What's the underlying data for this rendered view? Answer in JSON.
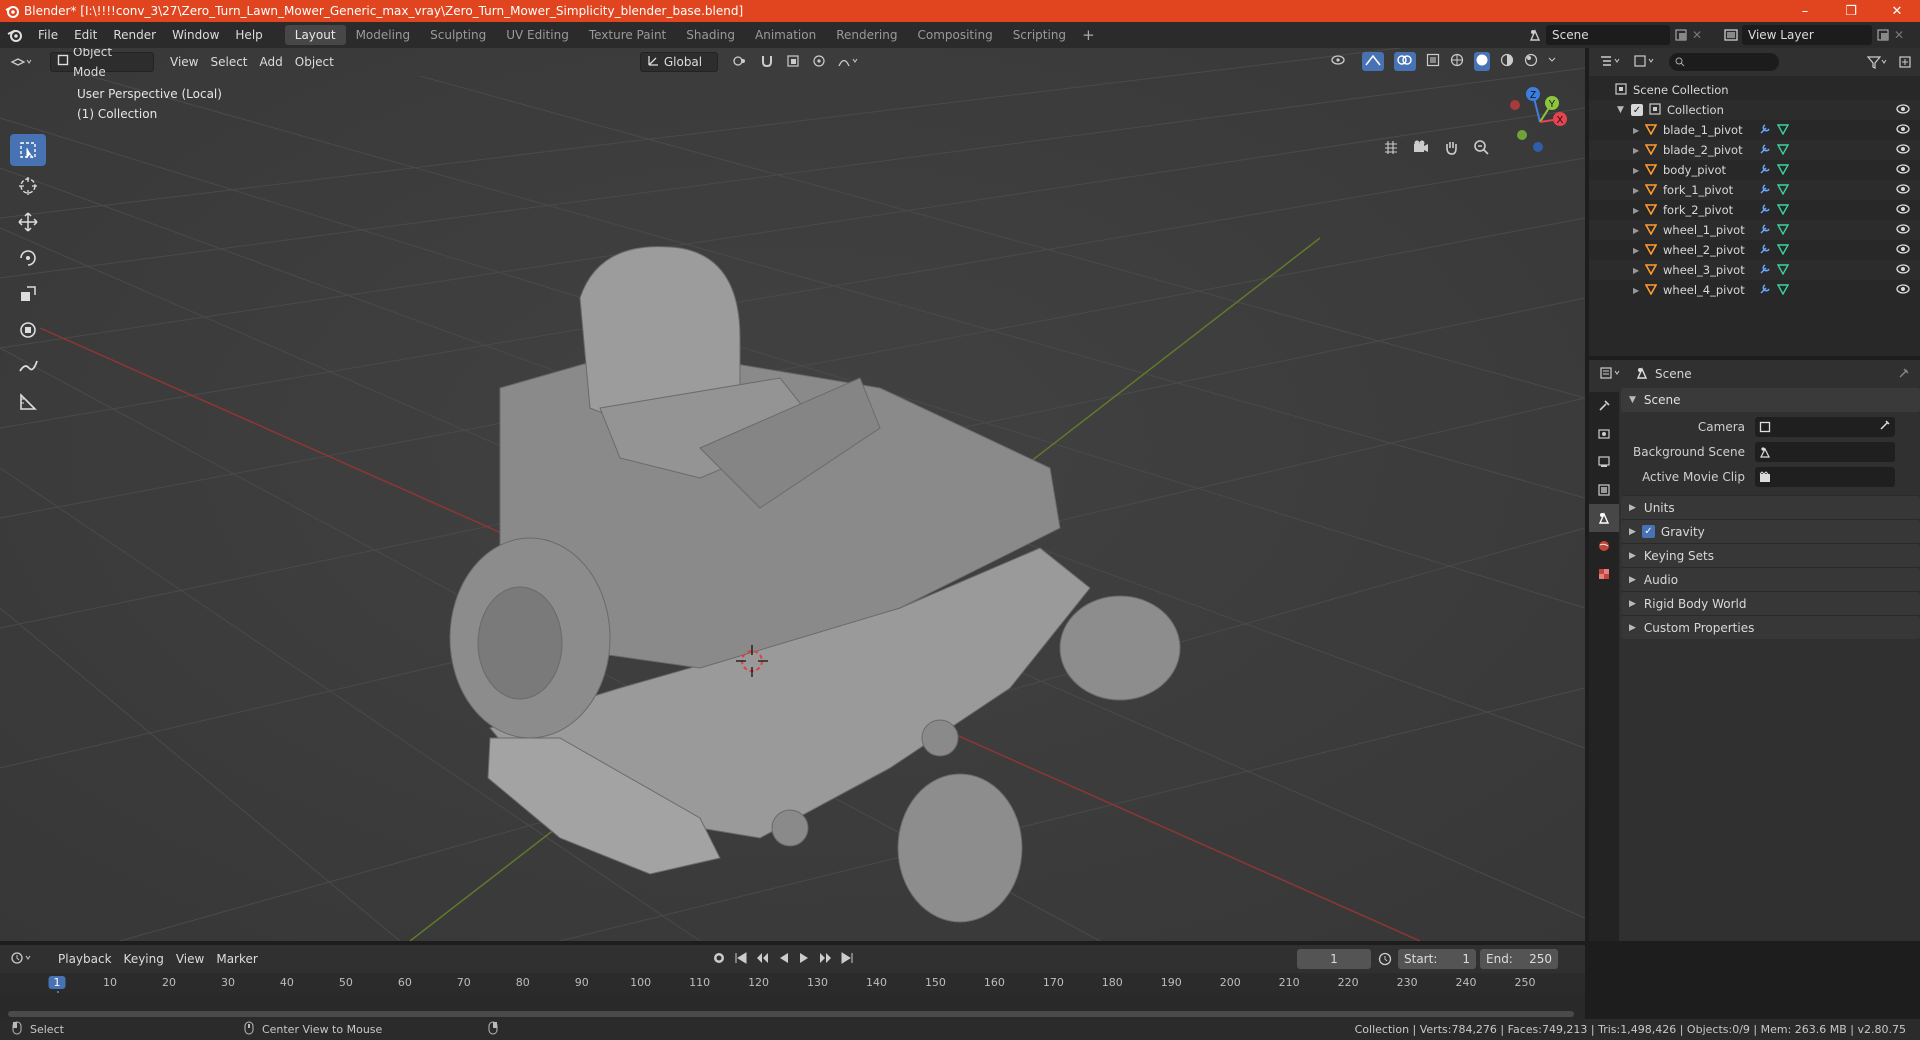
{
  "window": {
    "title": "Blender* [I:\\!!!!conv_3\\27\\Zero_Turn_Lawn_Mower_Generic_max_vray\\Zero_Turn_Mower_Simplicity_blender_base.blend]",
    "minimize": "–",
    "maximize": "❐",
    "close": "✕"
  },
  "menu": [
    "File",
    "Edit",
    "Render",
    "Window",
    "Help"
  ],
  "workspaces": [
    "Layout",
    "Modeling",
    "Sculpting",
    "UV Editing",
    "Texture Paint",
    "Shading",
    "Animation",
    "Rendering",
    "Compositing",
    "Scripting"
  ],
  "workspace_add": "+",
  "scene_name": "Scene",
  "view_layer": "View Layer",
  "viewport": {
    "mode": "Object Mode",
    "menus": [
      "View",
      "Select",
      "Add",
      "Object"
    ],
    "orientation": "Global",
    "info_line1": "User Perspective (Local)",
    "info_line2": "(1) Collection",
    "gizmo": {
      "x": "X",
      "y": "Y",
      "z": "Z"
    }
  },
  "outliner": {
    "scene_collection": "Scene Collection",
    "collection": "Collection",
    "items": [
      {
        "name": "blade_1_pivot"
      },
      {
        "name": "blade_2_pivot"
      },
      {
        "name": "body_pivot"
      },
      {
        "name": "fork_1_pivot"
      },
      {
        "name": "fork_2_pivot"
      },
      {
        "name": "wheel_1_pivot"
      },
      {
        "name": "wheel_2_pivot"
      },
      {
        "name": "wheel_3_pivot"
      },
      {
        "name": "wheel_4_pivot"
      }
    ]
  },
  "properties": {
    "context": "Scene",
    "panel": "Scene",
    "camera_label": "Camera",
    "background_scene_label": "Background Scene",
    "active_movie_clip_label": "Active Movie Clip",
    "sections": [
      "Units",
      "Gravity",
      "Keying Sets",
      "Audio",
      "Rigid Body World",
      "Custom Properties"
    ],
    "gravity_checked": true
  },
  "timeline": {
    "menus": [
      "Playback",
      "Keying",
      "View",
      "Marker"
    ],
    "current_frame": "1",
    "start_label": "Start:",
    "start_value": "1",
    "end_label": "End:",
    "end_value": "250",
    "ruler": [
      "1",
      "10",
      "20",
      "30",
      "40",
      "50",
      "60",
      "70",
      "80",
      "90",
      "100",
      "110",
      "120",
      "130",
      "140",
      "150",
      "160",
      "170",
      "180",
      "190",
      "200",
      "210",
      "220",
      "230",
      "240",
      "250"
    ]
  },
  "status": {
    "select": "Select",
    "center_view": "Center View to Mouse",
    "stats": "Collection | Verts:784,276 | Faces:749,213 | Tris:1,498,426 | Objects:0/9 | Mem: 263.6 MB | v2.80.75"
  },
  "colors": {
    "titlebar": "#e0451f",
    "accent": "#4772b3",
    "x_axis": "#e8434f",
    "y_axis": "#8cc63f",
    "z_axis": "#3c7fe0",
    "mesh_orange": "#ff9a2e",
    "modifier_blue": "#6aa8ff",
    "mesh_green": "#3cd1a0"
  }
}
